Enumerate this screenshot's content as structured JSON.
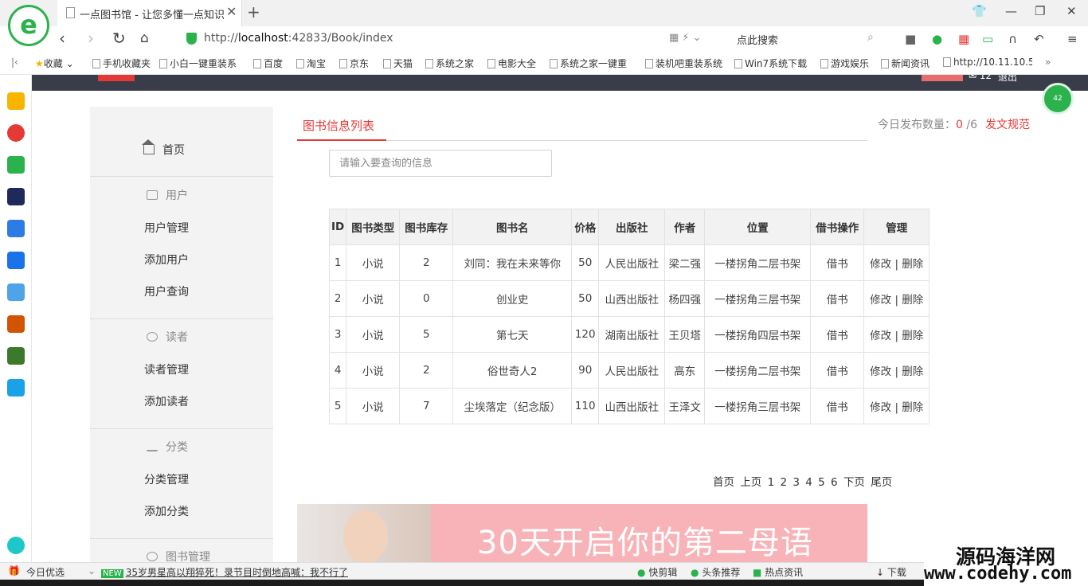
{
  "browser": {
    "tab_title": "一点图书馆 - 让您多懂一点知识",
    "tab_close": "✕",
    "new_tab": "+",
    "address_host": "localhost",
    "address": "http://localhost:42833/Book/index",
    "address_prefix": "http://",
    "address_suffix": ":42833/Book/index",
    "search_text": "点此搜索",
    "bookmarks": [
      "收藏",
      "手机收藏夹",
      "小白一键重装系",
      "百度",
      "淘宝",
      "京东",
      "天猫",
      "系统之家",
      "电影大全",
      "系统之家一键重",
      "装机吧重装系统",
      "Win7系统下载",
      "游戏娱乐",
      "新闻资讯",
      "http://10.11.10.5"
    ]
  },
  "sidebar": {
    "home": "首页",
    "sections": [
      {
        "title": "用户",
        "items": [
          "用户管理",
          "添加用户",
          "用户查询"
        ]
      },
      {
        "title": "读者",
        "items": [
          "读者管理",
          "添加读者"
        ]
      },
      {
        "title": "分类",
        "items": [
          "分类管理",
          "添加分类"
        ]
      },
      {
        "title": "图书管理",
        "items": []
      }
    ]
  },
  "main": {
    "tab": "图书信息列表",
    "publish_label": "今日发布数量：",
    "publish_count": "0",
    "publish_total": "/6",
    "publish_rules": "发文规范",
    "search_placeholder": "请输入要查询的信息"
  },
  "table": {
    "headers": [
      "ID",
      "图书类型",
      "图书库存",
      "图书名",
      "价格",
      "出版社",
      "作者",
      "位置",
      "借书操作",
      "管理"
    ],
    "rows": [
      [
        "1",
        "小说",
        "2",
        "刘同：我在未来等你",
        "50",
        "人民出版社",
        "梁二强",
        "一楼拐角二层书架",
        "借书",
        "修改 | 删除"
      ],
      [
        "2",
        "小说",
        "0",
        "创业史",
        "50",
        "山西出版社",
        "杨四强",
        "一楼拐角三层书架",
        "借书",
        "修改 | 删除"
      ],
      [
        "3",
        "小说",
        "5",
        "第七天",
        "120",
        "湖南出版社",
        "王贝塔",
        "一楼拐角四层书架",
        "借书",
        "修改 | 删除"
      ],
      [
        "4",
        "小说",
        "2",
        "俗世奇人2",
        "90",
        "人民出版社",
        "高东",
        "一楼拐角二层书架",
        "借书",
        "修改 | 删除"
      ],
      [
        "5",
        "小说",
        "7",
        "尘埃落定（纪念版）",
        "110",
        "山西出版社",
        "王泽文",
        "一楼拐角三层书架",
        "借书",
        "修改 | 删除"
      ]
    ]
  },
  "pager": [
    "首页",
    "上页",
    "1",
    "2",
    "3",
    "4",
    "5",
    "6",
    "下页",
    "尾页"
  ],
  "banner": {
    "text": "30天开启你的第二母语"
  },
  "header": {
    "messages": "12",
    "logout": "退出"
  },
  "float_badge": "42",
  "statusbar": {
    "today": "今日优选",
    "news_badge": "NEW",
    "news": "35岁男星高以翔猝死！录节目时倒地高喊：我不行了",
    "items": [
      "快剪辑",
      "头条推荐",
      "热点资讯",
      "下载"
    ]
  },
  "watermark": {
    "cn": "源码海洋网",
    "url": "www.codehy.com"
  }
}
